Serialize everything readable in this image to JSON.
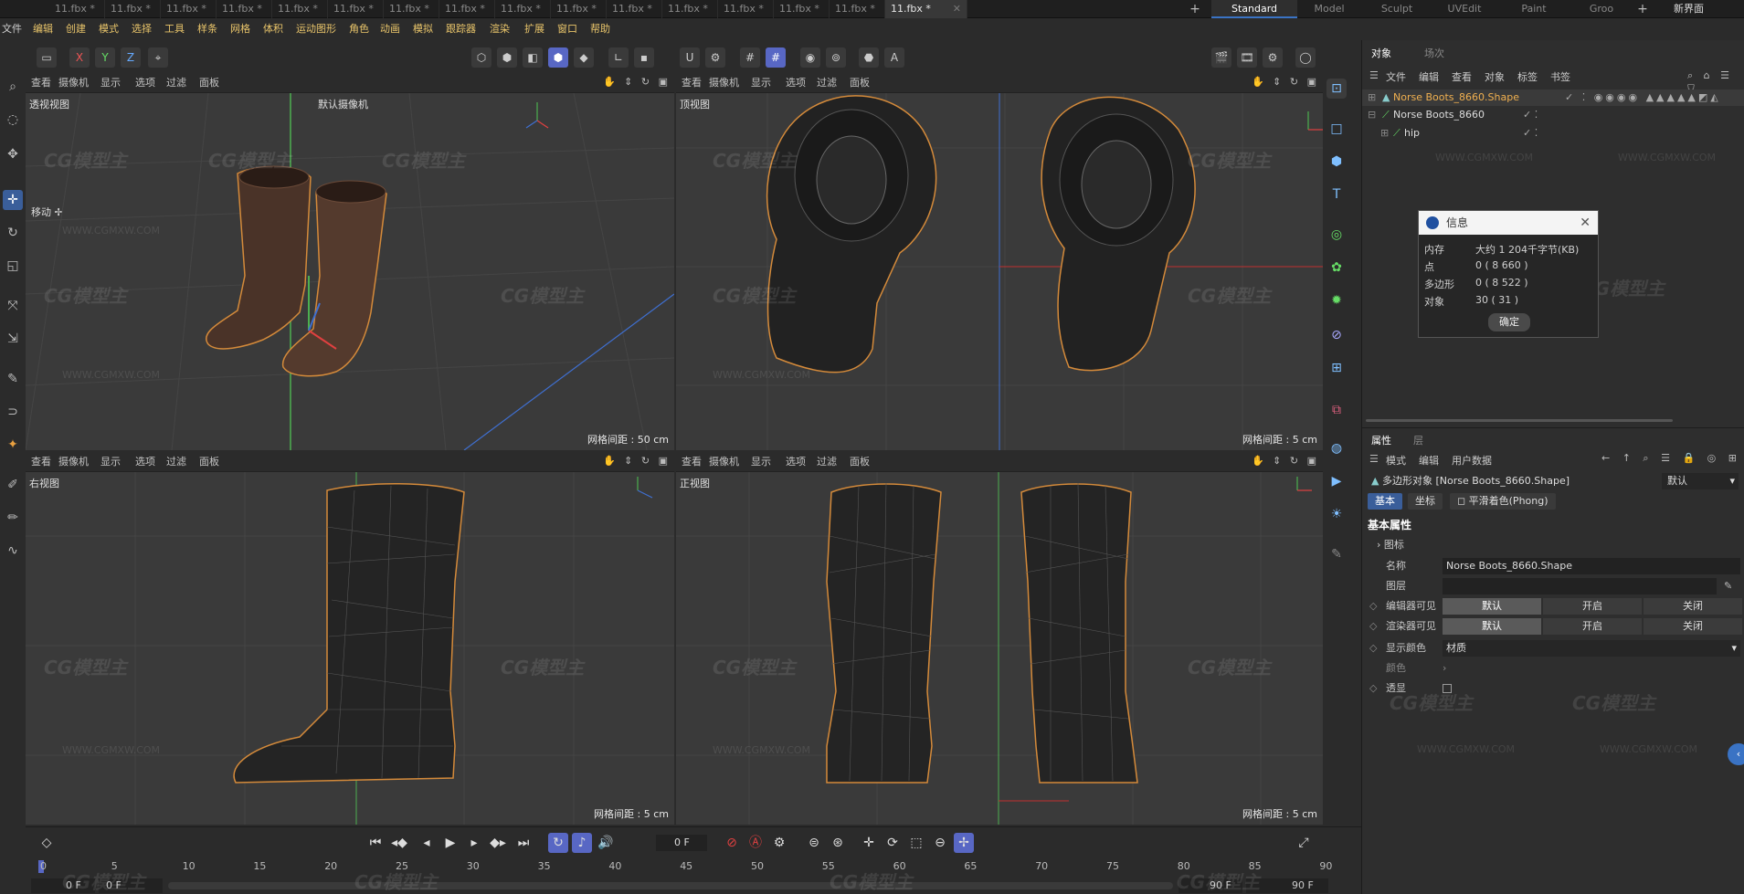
{
  "tabs": [
    {
      "label": "11.fbx *"
    },
    {
      "label": "11.fbx *"
    },
    {
      "label": "11.fbx *"
    },
    {
      "label": "11.fbx *"
    },
    {
      "label": "11.fbx *"
    },
    {
      "label": "11.fbx *"
    },
    {
      "label": "11.fbx *"
    },
    {
      "label": "11.fbx *"
    },
    {
      "label": "11.fbx *"
    },
    {
      "label": "11.fbx *"
    },
    {
      "label": "11.fbx *"
    },
    {
      "label": "11.fbx *"
    },
    {
      "label": "11.fbx *"
    },
    {
      "label": "11.fbx *"
    },
    {
      "label": "11.fbx *"
    },
    {
      "label": "11.fbx *"
    }
  ],
  "layouts": [
    "Standard",
    "Model",
    "Sculpt",
    "UVEdit",
    "Paint",
    "Groo"
  ],
  "new_interface": "新界面",
  "menus": [
    "文件",
    "编辑",
    "创建",
    "模式",
    "选择",
    "工具",
    "样条",
    "网格",
    "体积",
    "运动图形",
    "角色",
    "动画",
    "模拟",
    "跟踪器",
    "渲染",
    "扩展",
    "窗口",
    "帮助"
  ],
  "toolbar": {
    "axis_x": "X",
    "axis_y": "Y",
    "axis_z": "Z"
  },
  "viewports": {
    "persp": {
      "name": "透视视图",
      "camera": "默认摄像机",
      "grid": "网格间距 : 50 cm",
      "move_label": "移动"
    },
    "top": {
      "name": "顶视图",
      "grid": "网格间距 : 5 cm"
    },
    "right": {
      "name": "右视图",
      "grid": "网格间距 : 5 cm"
    },
    "front": {
      "name": "正视图",
      "grid": "网格间距 : 5 cm"
    }
  },
  "vpmenu": [
    "查看",
    "摄像机",
    "显示",
    "选项",
    "过滤",
    "面板"
  ],
  "watermark": {
    "logo": "CG模型主",
    "url": "WWW.CGMXW.COM"
  },
  "objects_panel": {
    "tabs": [
      "对象",
      "场次"
    ],
    "menu": [
      "文件",
      "编辑",
      "查看",
      "对象",
      "标签",
      "书签"
    ],
    "items": [
      {
        "name": "Norse Boots_8660.Shape"
      },
      {
        "name": "Norse Boots_8660"
      },
      {
        "name": "hip"
      }
    ]
  },
  "info_dialog": {
    "title": "信息",
    "rows": [
      {
        "label": "内存",
        "value": "大约 1 204千字节(KB)"
      },
      {
        "label": "点",
        "value": "0 ( 8 660 )"
      },
      {
        "label": "多边形",
        "value": "0 ( 8 522 )"
      },
      {
        "label": "对象",
        "value": "30 ( 31 )"
      }
    ],
    "ok": "确定"
  },
  "attributes": {
    "tabs": [
      "属性",
      "层"
    ],
    "menu": [
      "模式",
      "编辑",
      "用户数据"
    ],
    "object_title": "多边形对象 [Norse Boots_8660.Shape]",
    "preset": "默认",
    "subtabs": [
      "基本",
      "坐标",
      "平滑着色(Phong)"
    ],
    "section": "基本属性",
    "icon_label": "图标",
    "name_label": "名称",
    "name_value": "Norse Boots_8660.Shape",
    "layer_label": "图层",
    "editor_vis_label": "编辑器可见",
    "render_vis_label": "渲染器可见",
    "vis_options": [
      "默认",
      "开启",
      "关闭"
    ],
    "display_color_label": "显示颜色",
    "display_color_value": "材质",
    "color_label": "颜色",
    "transparency_label": "透显"
  },
  "timeline": {
    "current_frame": "0 F",
    "ticks": [
      "0",
      "5",
      "10",
      "15",
      "20",
      "25",
      "30",
      "35",
      "40",
      "45",
      "50",
      "55",
      "60",
      "65",
      "70",
      "75",
      "80",
      "85",
      "90"
    ],
    "start": "0 F",
    "start2": "0 F",
    "end": "90 F",
    "end2": "90 F"
  }
}
